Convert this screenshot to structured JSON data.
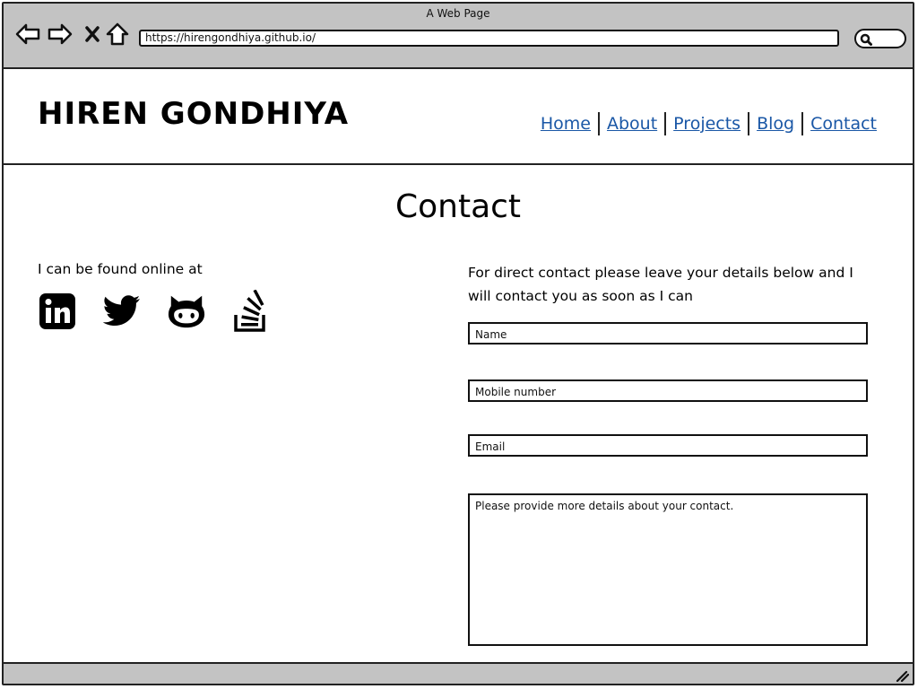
{
  "window": {
    "title": "A Web Page"
  },
  "toolbar": {
    "url": "https://hirengondhiya.github.io/"
  },
  "site": {
    "brand": "HIREN GONDHIYA",
    "nav": [
      "Home",
      "About",
      "Projects",
      "Blog",
      "Contact"
    ]
  },
  "page": {
    "title": "Contact",
    "left_intro": "I can be found online at",
    "social": [
      "linkedin-icon",
      "twitter-icon",
      "github-icon",
      "stackoverflow-icon"
    ],
    "right_intro": "For direct contact please leave your details below and I will contact you as soon as I can",
    "form": {
      "name_placeholder": "Name",
      "mobile_placeholder": "Mobile number",
      "email_placeholder": "Email",
      "details_placeholder": "Please provide more details about your contact."
    }
  },
  "colors": {
    "link": "#1a57a6",
    "chrome": "#c3c3c3"
  }
}
